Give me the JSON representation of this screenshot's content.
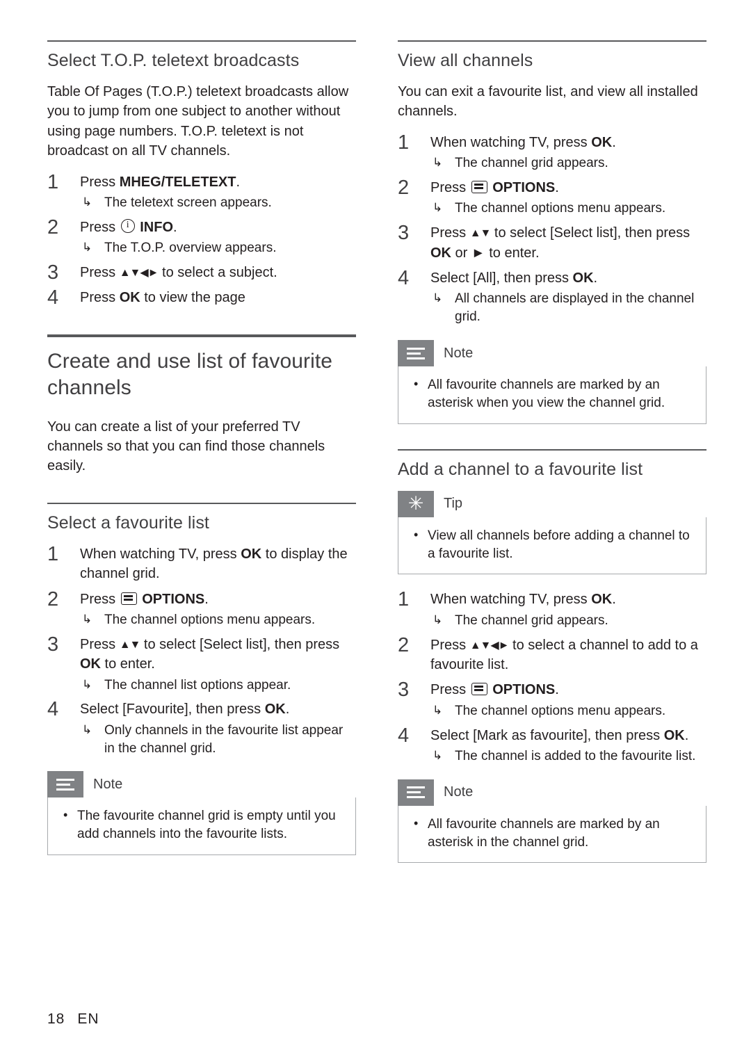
{
  "page": {
    "number": "18",
    "lang": "EN"
  },
  "left_column": {
    "section1": {
      "heading": "Select T.O.P. teletext broadcasts",
      "paragraph": "Table Of Pages (T.O.P.) teletext broadcasts allow you to jump from one subject to another without using page numbers. T.O.P. teletext is not broadcast on all TV channels.",
      "steps": [
        {
          "num": "1",
          "pre": "Press ",
          "bold": "MHEG/TELETEXT",
          "post": ".",
          "sub": "The teletext screen appears."
        },
        {
          "num": "2",
          "pre": "Press ",
          "icon": "info-icon",
          "bold": "INFO",
          "post": ".",
          "sub": "The T.O.P. overview appears."
        },
        {
          "num": "3",
          "pre": "Press ",
          "arrows": "▲▼◄►",
          "post": " to select a subject.",
          "sub": ""
        },
        {
          "num": "4",
          "pre": "Press ",
          "bold": "OK",
          "post": " to view the page",
          "sub": ""
        }
      ]
    },
    "chapter": {
      "title": "Create and use list of favourite channels",
      "paragraph": "You can create a list of your preferred TV channels so that you can find those channels easily."
    },
    "section2": {
      "heading": "Select a favourite list",
      "steps": [
        {
          "num": "1",
          "text_html": "When watching TV, press <b>OK</b> to display the channel grid.",
          "sub": ""
        },
        {
          "num": "2",
          "text_html": "Press <span class=\"icon-key options\"></span> <b>OPTIONS</b>.",
          "sub": "The channel options menu appears."
        },
        {
          "num": "3",
          "text_html": "Press <span class=\"arrows\">▲▼</span> to select [Select list], then press <b>OK</b> to enter.",
          "sub": "The channel list options appear."
        },
        {
          "num": "4",
          "text_html": "Select [Favourite], then press <b>OK</b>.",
          "sub": "Only channels in the favourite list appear in the channel grid."
        }
      ],
      "note": {
        "label": "Note",
        "items": [
          "The favourite channel grid is empty until you add channels into the favourite lists."
        ]
      }
    }
  },
  "right_column": {
    "section1": {
      "heading": "View all channels",
      "paragraph": "You can exit a favourite list, and view all installed channels.",
      "steps": [
        {
          "num": "1",
          "text_html": "When watching TV, press <b>OK</b>.",
          "sub": "The channel grid appears."
        },
        {
          "num": "2",
          "text_html": "Press <span class=\"icon-key options\"></span> <b>OPTIONS</b>.",
          "sub": "The channel options menu appears."
        },
        {
          "num": "3",
          "text_html": "Press <span class=\"arrows\">▲▼</span> to select [Select list], then press <b>OK</b> or ► to enter.",
          "sub": ""
        },
        {
          "num": "4",
          "text_html": "Select [All], then press <b>OK</b>.",
          "sub": "All channels are displayed in the channel grid."
        }
      ],
      "note": {
        "label": "Note",
        "items": [
          "All favourite channels are marked by an asterisk when you view the channel grid."
        ]
      }
    },
    "section2": {
      "heading": "Add a channel to a favourite list",
      "tip": {
        "label": "Tip",
        "items": [
          "View all channels before adding a channel to a favourite list."
        ]
      },
      "steps": [
        {
          "num": "1",
          "text_html": "When watching TV, press <b>OK</b>.",
          "sub": "The channel grid appears."
        },
        {
          "num": "2",
          "text_html": "Press <span class=\"arrows\">▲▼◄►</span> to select a channel to add to a favourite list.",
          "sub": ""
        },
        {
          "num": "3",
          "text_html": "Press <span class=\"icon-key options\"></span> <b>OPTIONS</b>.",
          "sub": "The channel options menu appears."
        },
        {
          "num": "4",
          "text_html": "Select [Mark as favourite], then press <b>OK</b>.",
          "sub": "The channel is added to the favourite list."
        }
      ],
      "note": {
        "label": "Note",
        "items": [
          "All favourite channels are marked by an asterisk in the channel grid."
        ]
      }
    }
  }
}
